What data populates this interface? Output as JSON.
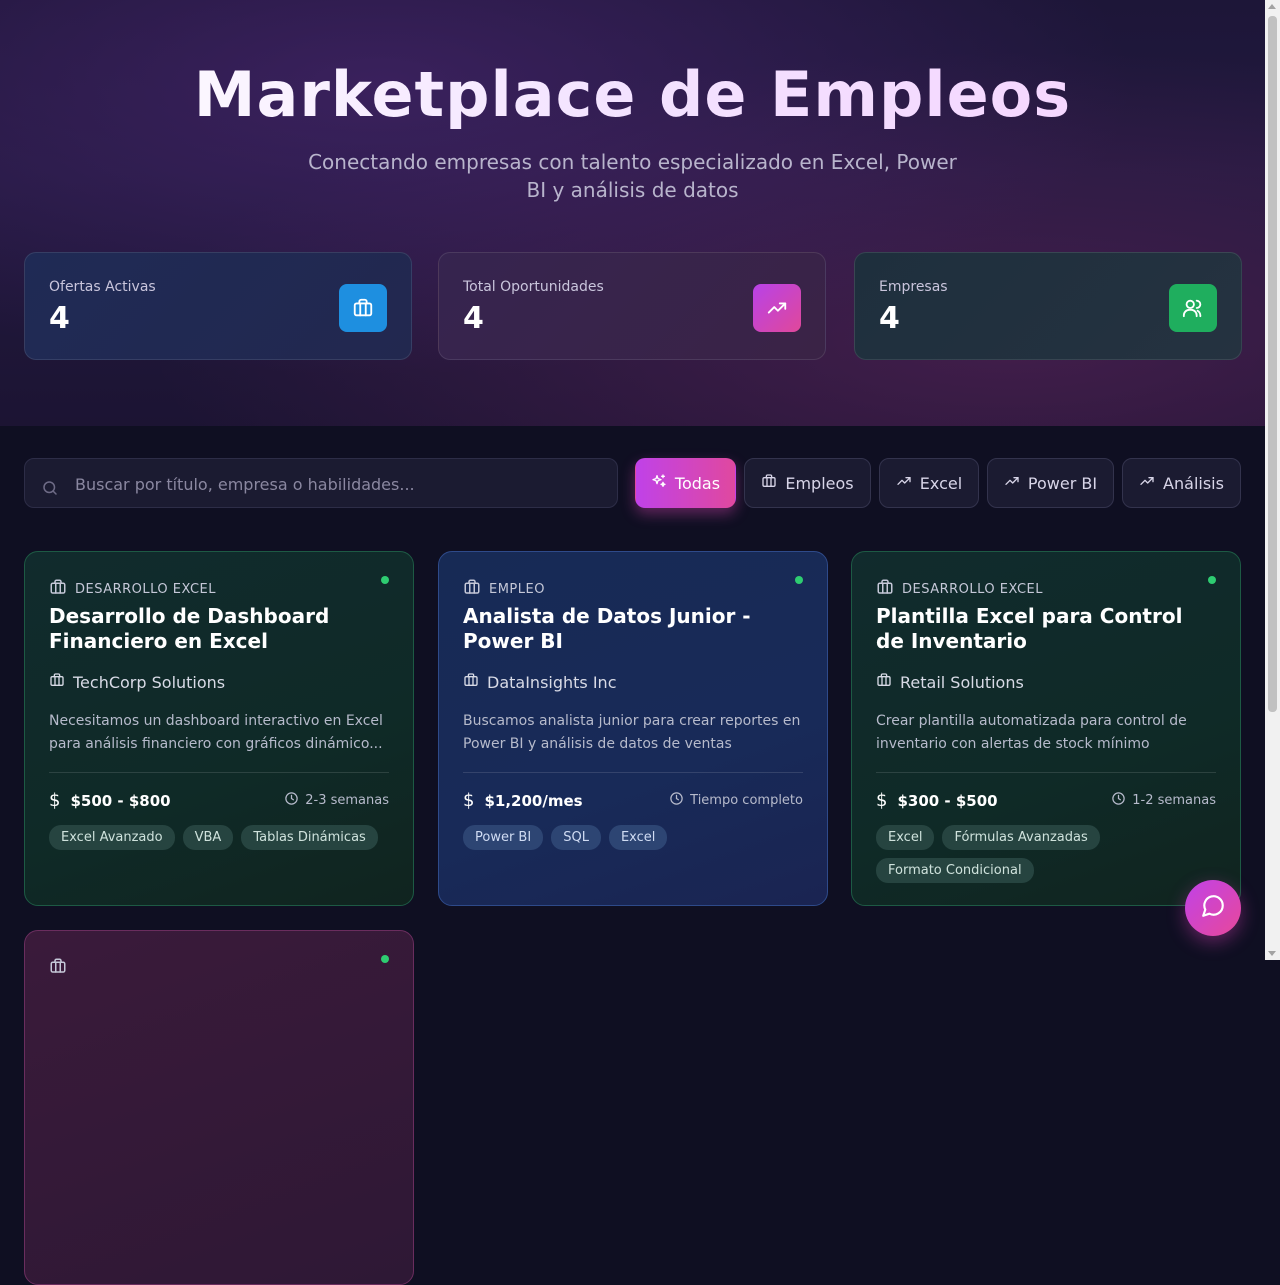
{
  "hero": {
    "title": "Marketplace de Empleos",
    "subtitle": "Conectando empresas con talento especializado en Excel, Power BI y análisis de datos"
  },
  "stats": [
    {
      "label": "Ofertas Activas",
      "value": "4",
      "icon": "briefcase-icon",
      "color": "#1e8fe0"
    },
    {
      "label": "Total Oportunidades",
      "value": "4",
      "icon": "trending-up-icon",
      "color": "#d13fe0"
    },
    {
      "label": "Empresas",
      "value": "4",
      "icon": "users-icon",
      "color": "#1fae5e"
    }
  ],
  "search": {
    "placeholder": "Buscar por título, empresa o habilidades..."
  },
  "filters": [
    {
      "label": "Todas",
      "icon": "sparkles-icon",
      "active": true
    },
    {
      "label": "Empleos",
      "icon": "briefcase-icon",
      "active": false
    },
    {
      "label": "Excel",
      "icon": "trending-up-icon",
      "active": false
    },
    {
      "label": "Power BI",
      "icon": "trending-up-icon",
      "active": false
    },
    {
      "label": "Análisis",
      "icon": "trending-up-icon",
      "active": false
    }
  ],
  "jobs": [
    {
      "category": "DESARROLLO EXCEL",
      "title": "Desarrollo de Dashboard Financiero en Excel",
      "company": "TechCorp Solutions",
      "description": "Necesitamos un dashboard interactivo en Excel para análisis financiero con gráficos dinámico...",
      "salary": "$500 - $800",
      "duration": "2-3 semanas",
      "tags": [
        "Excel Avanzado",
        "VBA",
        "Tablas Dinámicas"
      ]
    },
    {
      "category": "EMPLEO",
      "title": "Analista de Datos Junior - Power BI",
      "company": "DataInsights Inc",
      "description": "Buscamos analista junior para crear reportes en Power BI y análisis de datos de ventas",
      "salary": "$1,200/mes",
      "duration": "Tiempo completo",
      "tags": [
        "Power BI",
        "SQL",
        "Excel"
      ]
    },
    {
      "category": "DESARROLLO EXCEL",
      "title": "Plantilla Excel para Control de Inventario",
      "company": "Retail Solutions",
      "description": "Crear plantilla automatizada para control de inventario con alertas de stock mínimo",
      "salary": "$300 - $500",
      "duration": "1-2 semanas",
      "tags": [
        "Excel",
        "Fórmulas Avanzadas",
        "Formato Condicional"
      ]
    }
  ],
  "colors": {
    "accent": "#d445d0",
    "status_dot": "#2ecc71"
  }
}
